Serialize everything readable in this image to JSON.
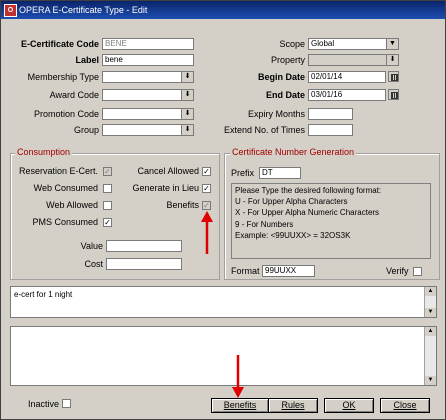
{
  "window": {
    "title": "OPERA E-Certificate Type - Edit",
    "app_icon": "opera-icon"
  },
  "form": {
    "ecert_code": {
      "label": "E-Certificate Code",
      "value": "BENE"
    },
    "label": {
      "label": "Label",
      "value": "bene"
    },
    "membership_type": {
      "label": "Membership Type",
      "value": ""
    },
    "award_code": {
      "label": "Award Code",
      "value": ""
    },
    "promotion_code": {
      "label": "Promotion Code",
      "value": ""
    },
    "group": {
      "label": "Group",
      "value": ""
    },
    "scope": {
      "label": "Scope",
      "value": "Global"
    },
    "property": {
      "label": "Property",
      "value": ""
    },
    "begin_date": {
      "label": "Begin Date",
      "value": "02/01/14"
    },
    "end_date": {
      "label": "End Date",
      "value": "03/01/16"
    },
    "expiry_months": {
      "label": "Expiry Months",
      "value": ""
    },
    "extend_times": {
      "label": "Extend No. of Times",
      "value": ""
    }
  },
  "consumption": {
    "title": "Consumption",
    "reservation_ecert": {
      "label": "Reservation E-Cert.",
      "checked": true,
      "disabled": true
    },
    "web_consumed": {
      "label": "Web Consumed",
      "checked": false
    },
    "web_allowed": {
      "label": "Web Allowed",
      "checked": false
    },
    "pms_consumed": {
      "label": "PMS Consumed",
      "checked": true
    },
    "cancel_allowed": {
      "label": "Cancel Allowed",
      "checked": true
    },
    "generate_in_lieu": {
      "label": "Generate in Lieu",
      "checked": true
    },
    "benefits": {
      "label": "Benefits",
      "checked": true,
      "disabled": true
    },
    "value": {
      "label": "Value",
      "value": ""
    },
    "cost": {
      "label": "Cost",
      "value": ""
    }
  },
  "cert_number": {
    "title": "Certificate Number Generation",
    "prefix": {
      "label": "Prefix",
      "value": "DT"
    },
    "help_lines": [
      "Please Type the desired following format:",
      "U - For Upper Alpha Characters",
      "X - For Upper Alpha Numeric Characters",
      "9 - For Numbers",
      "Example: <99UUXX> = 32OS3K"
    ],
    "format": {
      "label": "Format",
      "value": "99UUXX"
    },
    "verify": {
      "label": "Verify",
      "checked": false
    }
  },
  "description": {
    "text": "e-cert for 1 night"
  },
  "notes": {
    "text": ""
  },
  "footer": {
    "inactive": {
      "label": "Inactive",
      "checked": false
    },
    "buttons": {
      "benefits": "Benefits",
      "rules": "Rules",
      "ok": "OK",
      "close": "Close"
    }
  },
  "colors": {
    "annotation_arrow": "#e00000",
    "group_title": "#a00000",
    "titlebar": "#0a246a"
  }
}
